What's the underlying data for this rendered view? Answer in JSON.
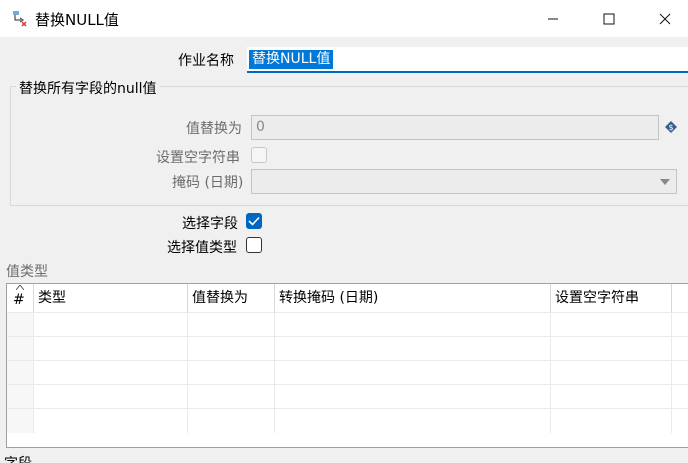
{
  "window": {
    "title": "替换NULL值"
  },
  "form": {
    "job_name_label": "作业名称",
    "job_name_value": "替换NULL值",
    "group_title": "替换所有字段的null值",
    "replace_value_label": "值替换为",
    "replace_value": "0",
    "set_empty_label": "设置空字符串",
    "mask_label": "掩码 (日期)",
    "mask_value": "",
    "select_fields_label": "选择字段",
    "select_fields_checked": true,
    "select_value_type_label": "选择值类型",
    "select_value_type_checked": false
  },
  "value_type_section": {
    "title": "值类型",
    "columns": [
      "#",
      "类型",
      "值替换为",
      "转换掩码 (日期)",
      "设置空字符串"
    ],
    "rows": [
      [
        "",
        "",
        "",
        "",
        ""
      ],
      [
        "",
        "",
        "",
        "",
        ""
      ],
      [
        "",
        "",
        "",
        "",
        ""
      ],
      [
        "",
        "",
        "",
        "",
        ""
      ],
      [
        "",
        "",
        "",
        "",
        ""
      ]
    ]
  },
  "fields_section": {
    "title": "字段"
  },
  "colors": {
    "accent": "#0067c0",
    "selection": "#0078d7"
  },
  "icons": [
    "app-transform-icon",
    "minimize-icon",
    "maximize-icon",
    "close-icon",
    "variable-diamond-icon",
    "dropdown-arrow-icon",
    "checkmark-icon",
    "sort-up-icon"
  ]
}
